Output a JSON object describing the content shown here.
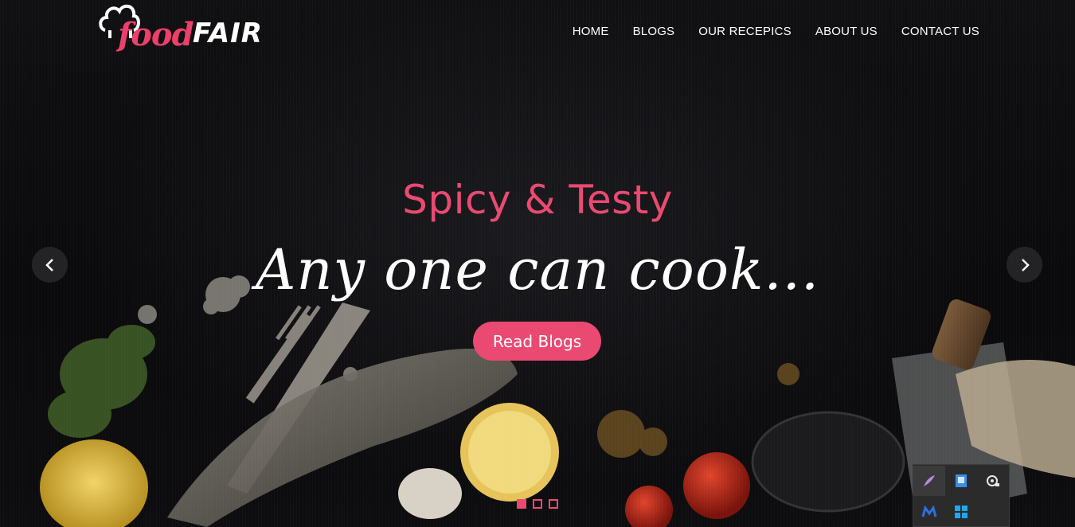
{
  "brand": {
    "part1": "food",
    "part2": "FAIR"
  },
  "nav": [
    {
      "label": "HOME"
    },
    {
      "label": "BLOGS"
    },
    {
      "label": "OUR RECEPICS"
    },
    {
      "label": "ABOUT US"
    },
    {
      "label": "CONTACT US"
    }
  ],
  "slide": {
    "subtitle": "Spicy & Testy",
    "headline": "Any one can cook...",
    "cta_label": "Read Blogs"
  },
  "carousel": {
    "slide_count": 3,
    "active_index": 0
  },
  "colors": {
    "accent": "#ea4a72",
    "background": "#0b0b0d",
    "text": "#ffffff"
  },
  "tray_icons": [
    "feather-icon",
    "network-monitor-icon",
    "camera-icon",
    "malwarebytes-icon",
    "windows-icon"
  ]
}
